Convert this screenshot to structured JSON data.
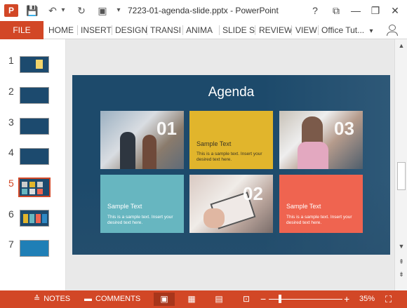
{
  "titlebar": {
    "app_logo": "P",
    "save_icon": "💾",
    "undo_icon": "↶",
    "undo_dropdown": "▾",
    "redo_icon": "↻",
    "present_icon": "▣",
    "customize_icon": "▾",
    "document_title": "7223-01-agenda-slide.pptx - PowerPoint",
    "help_icon": "?",
    "ribbon_display_icon": "⧉",
    "minimize_icon": "—",
    "restore_icon": "❐",
    "close_icon": "✕"
  },
  "ribbon": {
    "file_label": "FILE",
    "tabs": [
      "HOME",
      "INSERT",
      "DESIGN",
      "TRANSI",
      "ANIMA",
      "SLIDE S",
      "REVIEW",
      "VIEW"
    ],
    "account_label": "Office Tut...",
    "account_dropdown": "▾"
  },
  "thumbnails": {
    "numbers": [
      "1",
      "2",
      "3",
      "4",
      "5",
      "6",
      "7"
    ],
    "selected_index": 5
  },
  "slide": {
    "title": "Agenda",
    "tiles": [
      {
        "type": "photo",
        "number": "01"
      },
      {
        "type": "text",
        "heading": "Sample Text",
        "body": "This is a sample text. Insert your desired text here.",
        "color": "#e1b52c"
      },
      {
        "type": "photo",
        "number": "03"
      },
      {
        "type": "text",
        "heading": "Sample Text",
        "body": "This is a sample text. Insert your desired text here.",
        "color": "#67b6c0"
      },
      {
        "type": "photo",
        "number": "02"
      },
      {
        "type": "text",
        "heading": "Sample Text",
        "body": "This is a sample text. Insert your desired text here.",
        "color": "#ef6450"
      }
    ]
  },
  "scrollbar": {
    "up_icon": "▲",
    "down_icon": "▼",
    "prev_slide_icon": "⇞",
    "next_slide_icon": "⇟"
  },
  "statusbar": {
    "notes_icon": "≙",
    "notes_label": "NOTES",
    "comments_icon": "▬",
    "comments_label": "COMMENTS",
    "normal_view_icon": "▣",
    "sorter_view_icon": "▦",
    "reading_view_icon": "▤",
    "slideshow_icon": "⊡",
    "zoom_out_icon": "−",
    "zoom_in_icon": "+",
    "zoom_level": "35%",
    "fit_icon": "⛶"
  },
  "colors": {
    "accent": "#d24726",
    "slide_bg": "#1d4a6b"
  }
}
